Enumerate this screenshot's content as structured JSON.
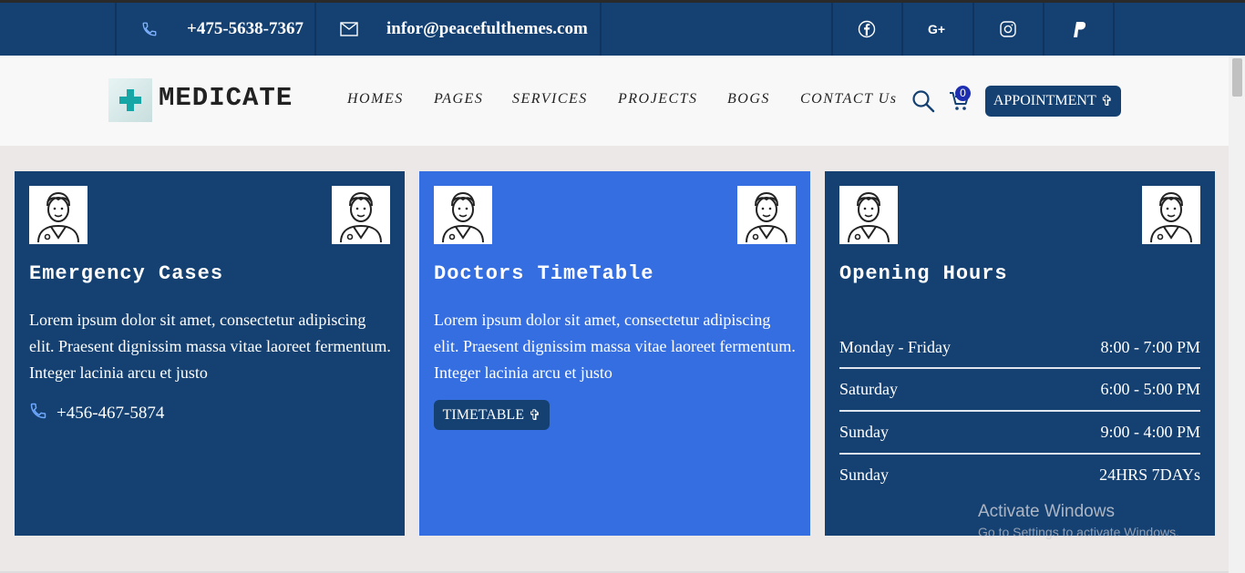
{
  "topbar": {
    "phone": "+475-5638-7367",
    "email": "infor@peacefulthemes.com",
    "social": [
      "facebook-icon",
      "google-plus-icon",
      "instagram-icon",
      "paypal-icon"
    ]
  },
  "nav": {
    "logo_text": "MEDICATE",
    "items": [
      "HOMES",
      "PAGES",
      "SERVICES",
      "PROJECTS",
      "BOGS",
      "CONTACT Us"
    ],
    "cart_count": "0",
    "appointment_label": "APPOINTMENT",
    "appointment_icon": "✞"
  },
  "cards": [
    {
      "title": "Emergency Cases",
      "text": "Lorem ipsum dolor sit amet, consectetur adipiscing elit. Praesent dignissim massa vitae laoreet fermentum. Integer lacinia arcu et justo",
      "phone": "+456-467-5874"
    },
    {
      "title": "Doctors TimeTable",
      "text": "Lorem ipsum dolor sit amet, consectetur adipiscing elit. Praesent dignissim massa vitae laoreet fermentum. Integer lacinia arcu et justo",
      "button_label": "TIMETABLE",
      "button_icon": "✞"
    },
    {
      "title": "Opening Hours",
      "hours": [
        {
          "day": "Monday - Friday",
          "time": "8:00 - 7:00 PM"
        },
        {
          "day": "Saturday",
          "time": "6:00 - 5:00 PM"
        },
        {
          "day": "Sunday",
          "time": "9:00 - 4:00 PM"
        },
        {
          "day": "Sunday",
          "time": "24HRS 7DAYs"
        }
      ]
    }
  ],
  "watermark": {
    "line1": "Activate Windows",
    "line2": "Go to Settings to activate Windows."
  },
  "colors": {
    "navy": "#154172",
    "bright_blue": "#356ee0",
    "teal_logo": "#17a6a6"
  }
}
